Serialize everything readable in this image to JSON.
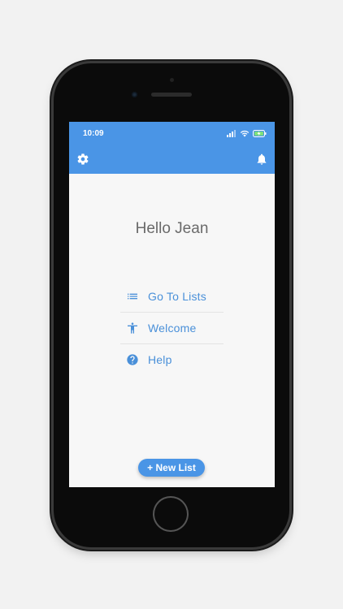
{
  "status_bar": {
    "time": "10:09"
  },
  "appbar": {
    "settings_icon": "gear-icon",
    "notifications_icon": "bell-icon"
  },
  "greeting": "Hello Jean",
  "menu": {
    "items": [
      {
        "label": "Go To Lists",
        "icon": "list-icon"
      },
      {
        "label": "Welcome",
        "icon": "accessibility-icon"
      },
      {
        "label": "Help",
        "icon": "help-circle-icon"
      }
    ]
  },
  "fab": {
    "label": "+ New List"
  },
  "colors": {
    "accent": "#4a95e6",
    "link": "#4a90d9",
    "background": "#f7f7f7",
    "greeting": "#6a6a6a"
  }
}
